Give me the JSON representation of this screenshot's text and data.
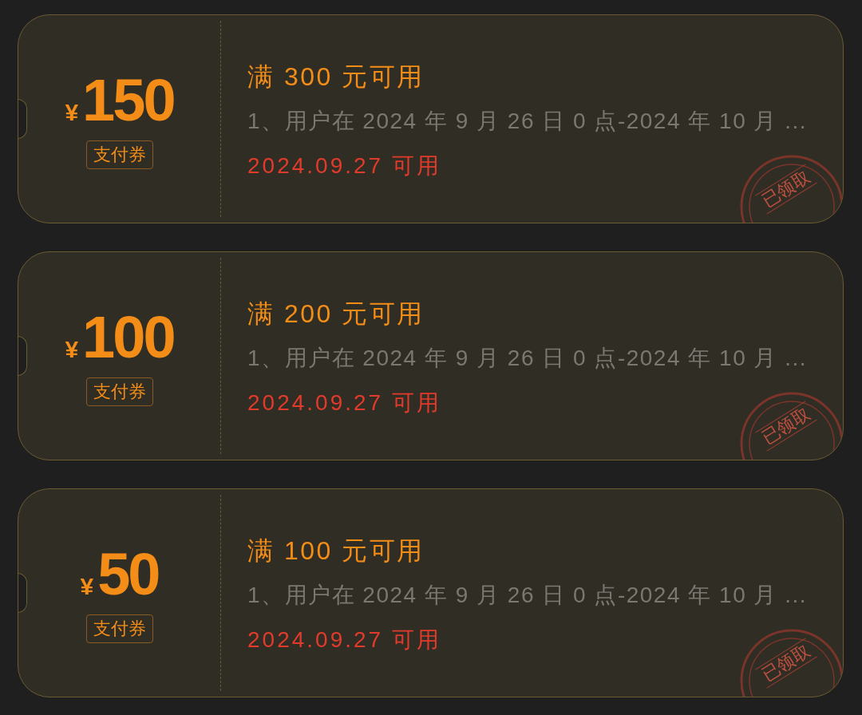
{
  "coupons": [
    {
      "currency": "¥",
      "amount": "150",
      "badge": "支付券",
      "condition": "满 300 元可用",
      "description": "1、用户在 2024 年 9 月 26 日 0 点-2024 年 10 月 ...",
      "valid_date": "2024.09.27 可用",
      "claimed": true,
      "stamp_text": "已领取"
    },
    {
      "currency": "¥",
      "amount": "100",
      "badge": "支付券",
      "condition": "满 200 元可用",
      "description": "1、用户在 2024 年 9 月 26 日 0 点-2024 年 10 月 ...",
      "valid_date": "2024.09.27 可用",
      "claimed": true,
      "stamp_text": "已领取"
    },
    {
      "currency": "¥",
      "amount": "50",
      "badge": "支付券",
      "condition": "满 100 元可用",
      "description": "1、用户在 2024 年 9 月 26 日 0 点-2024 年 10 月 ...",
      "valid_date": "2024.09.27 可用",
      "claimed": true,
      "stamp_text": "已领取"
    }
  ]
}
